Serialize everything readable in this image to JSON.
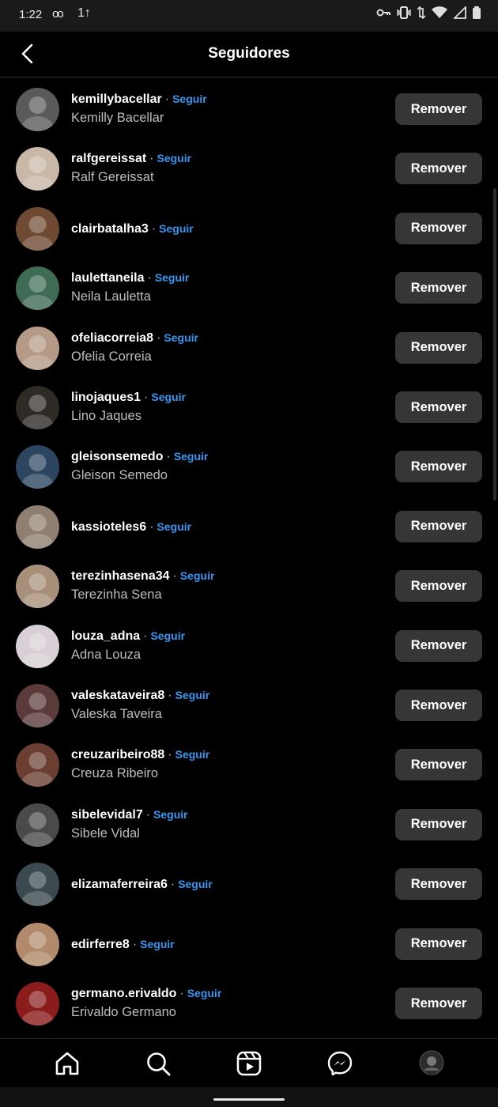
{
  "status_bar": {
    "time": "1:22",
    "voicemail": "oo",
    "data_indicator": "1↑",
    "icons": [
      "key-icon",
      "vibrate-icon",
      "data-arrows-icon",
      "wifi-icon",
      "signal-icon",
      "battery-icon"
    ]
  },
  "header": {
    "title": "Seguidores",
    "back_icon": "back-chevron-icon"
  },
  "follow_label": "Seguir",
  "separator": "·",
  "remove_label": "Remover",
  "followers": [
    {
      "username": "kemillybacellar",
      "full_name": "Kemilly Bacellar",
      "avatar_color": "#5a5a5a"
    },
    {
      "username": "ralfgereissat",
      "full_name": "Ralf Gereissat",
      "avatar_color": "#c9b7a8"
    },
    {
      "username": "clairbatalha3",
      "full_name": "",
      "avatar_color": "#6e4a33"
    },
    {
      "username": "laulettaneila",
      "full_name": "Neila Lauletta",
      "avatar_color": "#3f6b55"
    },
    {
      "username": "ofeliacorreia8",
      "full_name": "Ofelia Correia",
      "avatar_color": "#b59a85"
    },
    {
      "username": "linojaques1",
      "full_name": "Lino Jaques",
      "avatar_color": "#2e2a26"
    },
    {
      "username": "gleisonsemedo",
      "full_name": "Gleison Semedo",
      "avatar_color": "#2c4660"
    },
    {
      "username": "kassioteles6",
      "full_name": "",
      "avatar_color": "#8f7f70"
    },
    {
      "username": "terezinhasena34",
      "full_name": "Terezinha Sena",
      "avatar_color": "#a88f7a"
    },
    {
      "username": "louza_adna",
      "full_name": "Adna Louza",
      "avatar_color": "#d8d0d6"
    },
    {
      "username": "valeskataveira8",
      "full_name": "Valeska Taveira",
      "avatar_color": "#5b3a3a"
    },
    {
      "username": "creuzaribeiro88",
      "full_name": "Creuza Ribeiro",
      "avatar_color": "#6a3f32"
    },
    {
      "username": "sibelevidal7",
      "full_name": "Sibele Vidal",
      "avatar_color": "#4a4a4a"
    },
    {
      "username": "elizamaferreira6",
      "full_name": "",
      "avatar_color": "#3b4a4f"
    },
    {
      "username": "edirferre8",
      "full_name": "",
      "avatar_color": "#b08a6a"
    },
    {
      "username": "germano.erivaldo",
      "full_name": "Erivaldo Germano",
      "avatar_color": "#8a1c1c"
    }
  ],
  "bottom_nav": [
    "home-icon",
    "search-icon",
    "reels-icon",
    "messenger-icon",
    "profile-avatar"
  ],
  "colors": {
    "background": "#000000",
    "accent": "#3897f0",
    "button": "#363636",
    "secondary_text": "#bdbdbd"
  }
}
